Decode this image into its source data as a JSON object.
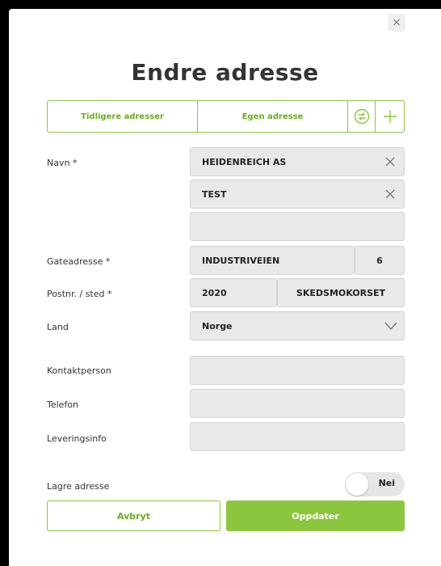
{
  "dialog": {
    "close_label": "×",
    "title": "Endre adresse",
    "tabs": [
      {
        "label": "Tidligere adresser"
      },
      {
        "label": "Egen adresse"
      }
    ],
    "icons": [
      "swap-address-icon",
      "add-icon"
    ],
    "colors": {
      "accent": "#8cc63f",
      "accent_text": "#6aad1f",
      "field_bg": "#e9e9e9"
    }
  },
  "form": {
    "navn_label": "Navn *",
    "navn_1": "HEIDENREICH AS",
    "navn_2": "TEST",
    "navn_3": "",
    "gateadresse_label": "Gateadresse *",
    "gateadresse": "INDUSTRIVEIEN",
    "husnummer": "6",
    "postnr_label": "Postnr. / sted *",
    "postnr": "2020",
    "sted": "SKEDSMOKORSET",
    "land_label": "Land",
    "land": "Norge",
    "kontakt_label": "Kontaktperson",
    "kontakt": "",
    "telefon_label": "Telefon",
    "telefon": "",
    "levering_label": "Leveringsinfo",
    "levering": "",
    "lagre_label": "Lagre adresse",
    "lagre_toggle": "Nei"
  },
  "buttons": {
    "cancel": "Avbryt",
    "update": "Oppdater"
  }
}
